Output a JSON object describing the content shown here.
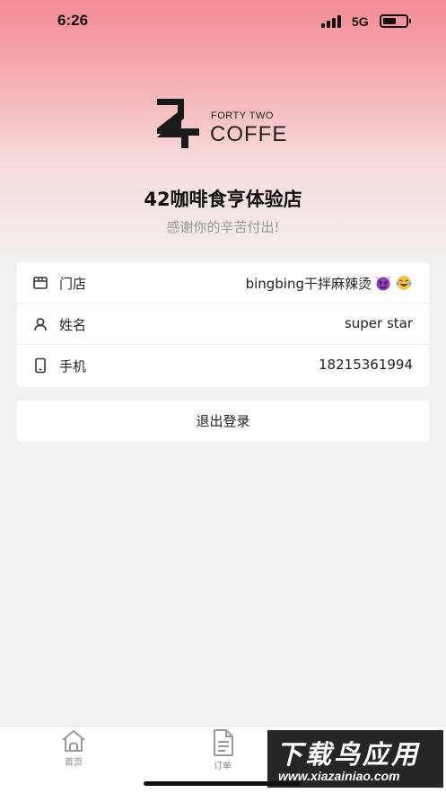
{
  "status": {
    "time": "6:26",
    "network": "5G",
    "battery_level": 0.6
  },
  "brand": {
    "line1": "FORTY TWO",
    "line2": "COFFE"
  },
  "store": {
    "title": "42咖啡食亨体验店",
    "subtitle": "感谢你的辛苦付出!"
  },
  "info": [
    {
      "icon": "store-icon",
      "label": "门店",
      "value": "bingbing干拌麻辣烫",
      "emoji": [
        "devil-emoji",
        "laughing-tears-emoji"
      ]
    },
    {
      "icon": "user-icon",
      "label": "姓名",
      "value": "super star"
    },
    {
      "icon": "phone-icon",
      "label": "手机",
      "value": "18215361994"
    }
  ],
  "logout_label": "退出登录",
  "tabs": [
    {
      "icon": "home-icon",
      "label": "首页"
    },
    {
      "icon": "document-icon",
      "label": "订单"
    },
    {
      "icon": "profile-icon",
      "label": ""
    }
  ],
  "watermark": {
    "line1": "下载鸟应用",
    "line2": "www.xiazainiao.com"
  },
  "colors": {
    "header_gradient_top": "#f28c93",
    "background": "#f1f1f1",
    "watermark_bg": "#262626"
  }
}
